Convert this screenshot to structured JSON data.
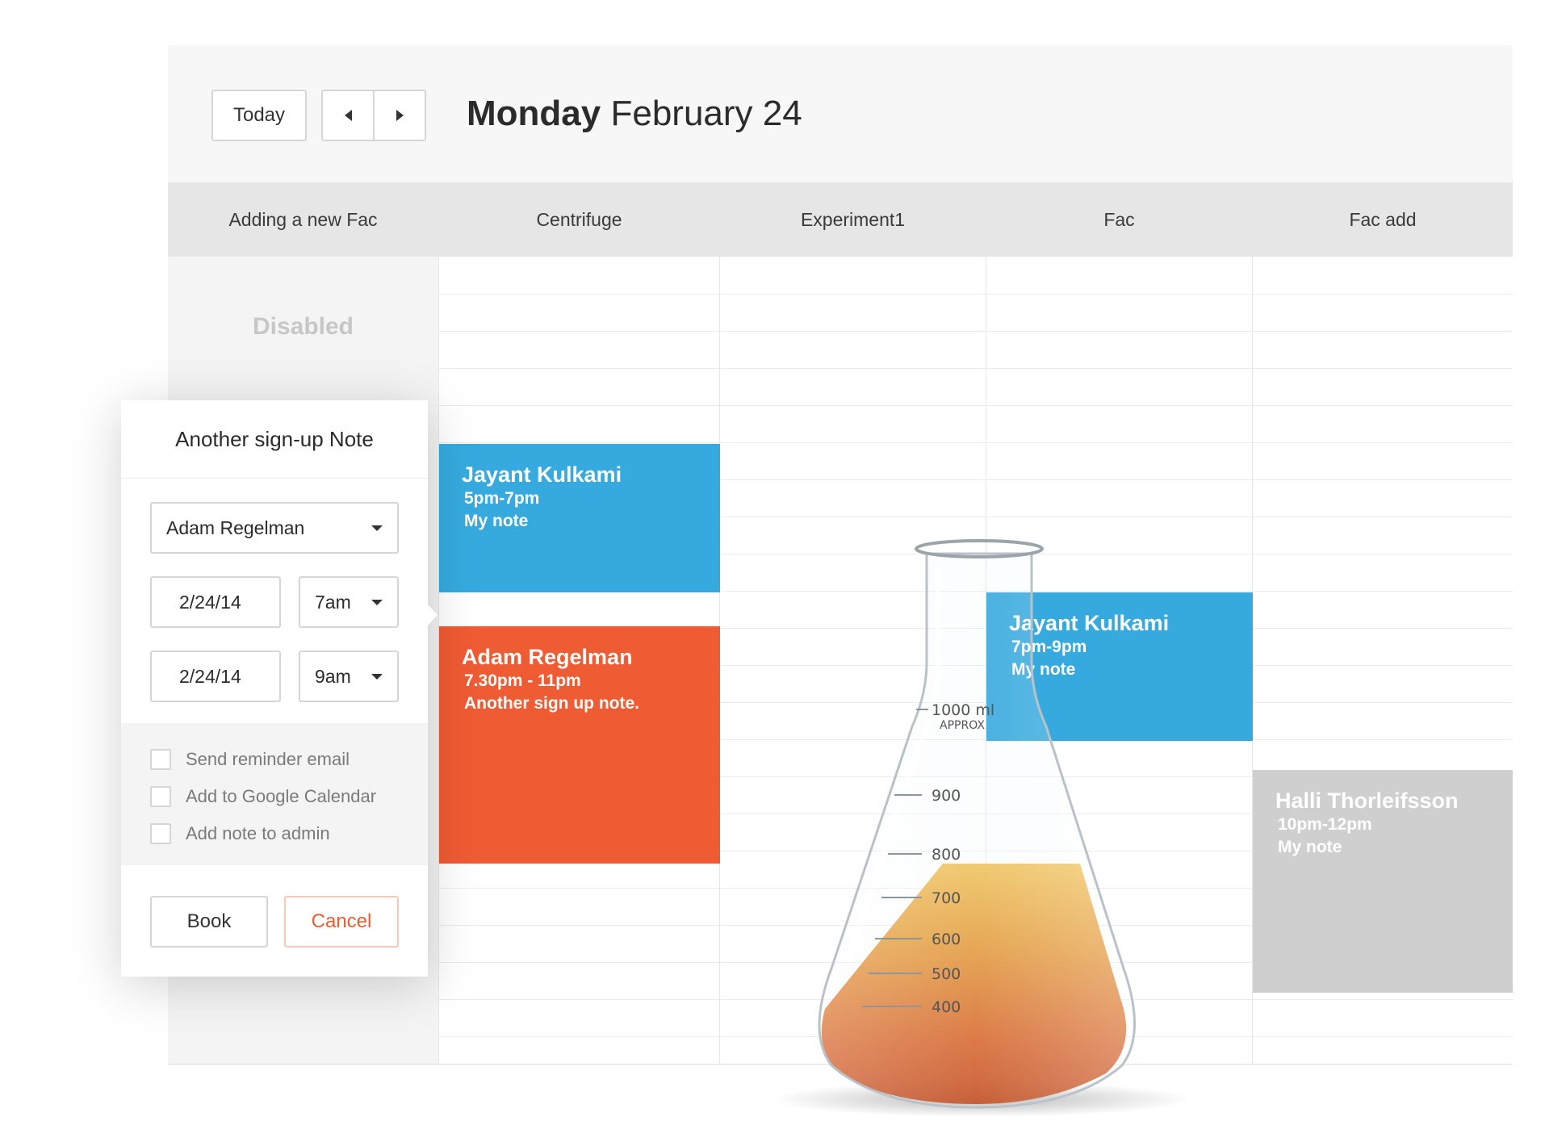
{
  "toolbar": {
    "today_label": "Today",
    "date_weekday": "Monday",
    "date_rest": "February 24"
  },
  "columns": [
    {
      "name": "Adding a new Fac",
      "status": "Disabled"
    },
    {
      "name": "Centrifuge"
    },
    {
      "name": "Experiment1"
    },
    {
      "name": "Fac"
    },
    {
      "name": "Fac add"
    }
  ],
  "events": [
    {
      "name": "Jayant Kulkami",
      "time": "5pm-7pm",
      "note": "My note",
      "color": "#36aadf"
    },
    {
      "name": "Adam Regelman",
      "time": "7.30pm - 11pm",
      "note": "Another sign up note.",
      "color": "#ef5b33"
    },
    {
      "name": "Jayant Kulkami",
      "time": "7pm-9pm",
      "note": "My note",
      "color": "#36aadf"
    },
    {
      "name": "Halli Thorleifsson",
      "time": "10pm-12pm",
      "note": "My note",
      "color": "#cfcfcf"
    }
  ],
  "popover": {
    "title": "Another sign-up Note",
    "user_select": "Adam Regelman",
    "start_date": "2/24/14",
    "start_time": "7am",
    "end_date": "2/24/14",
    "end_time": "9am",
    "options": [
      "Send reminder email",
      "Add to Google Calendar",
      "Add note to admin"
    ],
    "book_label": "Book",
    "cancel_label": "Cancel"
  },
  "flask": {
    "main_mark": "1000 ml",
    "approx": "APPROX",
    "marks": [
      "900",
      "800",
      "700",
      "600",
      "500",
      "400"
    ]
  },
  "colors": {
    "blue_event": "#36aadf",
    "orange_event": "#ef5b33",
    "gray_event": "#cfcfcf",
    "cancel_text": "#f05a30"
  }
}
